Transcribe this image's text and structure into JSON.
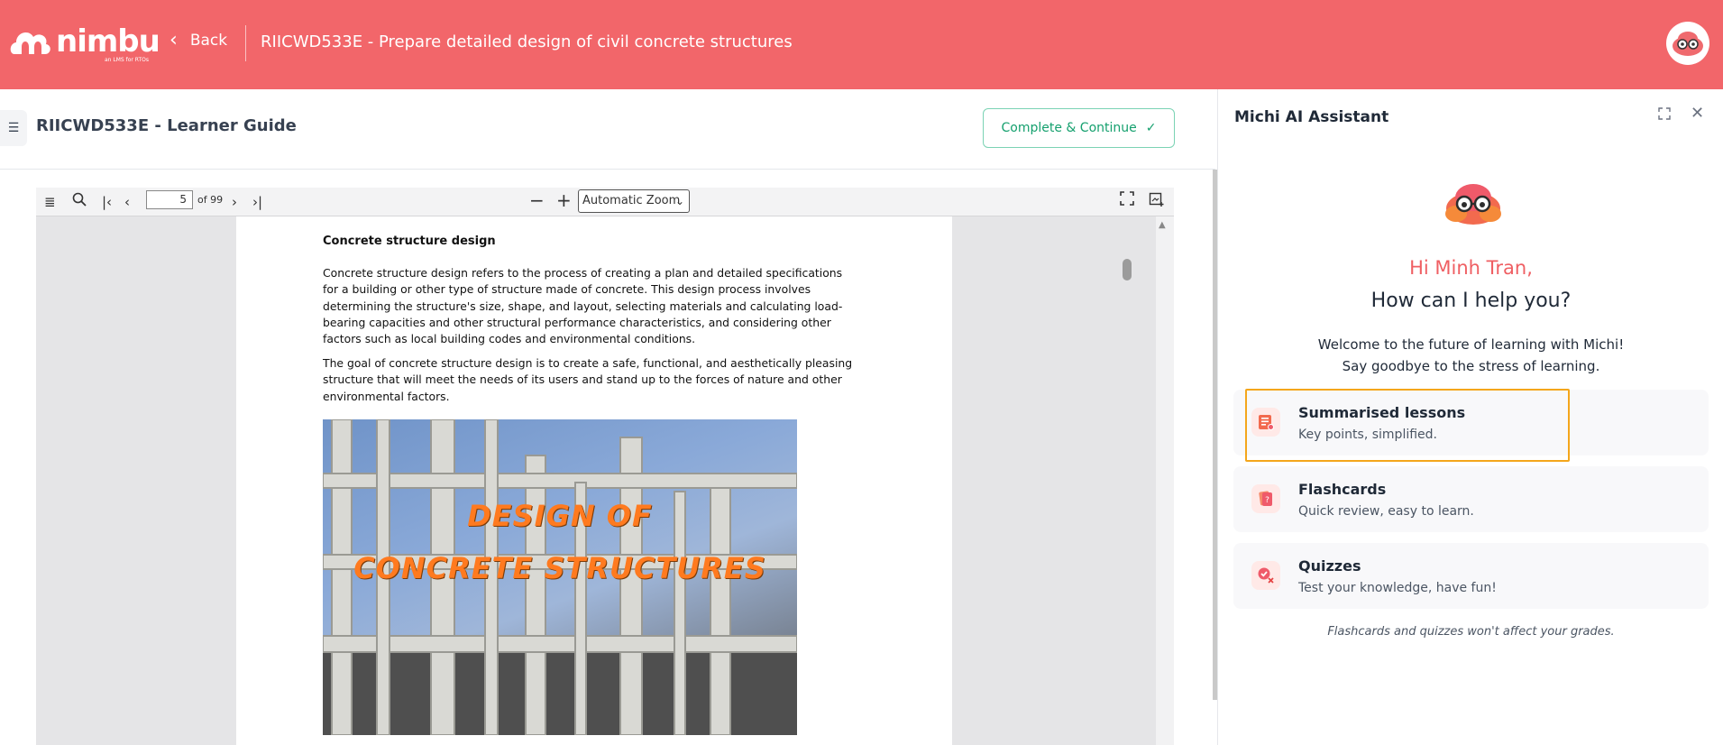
{
  "header": {
    "logo_text": "nimbu",
    "logo_tagline": "an LMS for RTOs",
    "back_label": "Back",
    "course_title": "RIICWD533E - Prepare detailed design of civil concrete structures"
  },
  "content": {
    "guide_title": "RIICWD533E - Learner Guide",
    "complete_button": "Complete & Continue",
    "complete_check": "✓"
  },
  "pdf_viewer": {
    "current_page": "5",
    "page_of": "of 99",
    "zoom": "Automatic Zoom",
    "page": {
      "heading": "Concrete structure design",
      "paragraph1": "Concrete structure design refers to the process of creating a plan and detailed specifications for a building or other type of structure made of concrete. This design process involves determining the structure's size, shape, and layout, selecting materials and calculating load-bearing capacities and other structural performance characteristics, and considering other factors such as local building codes and environmental conditions.",
      "paragraph2": "The goal of concrete structure design is to create a safe, functional, and aesthetically pleasing structure that will meet the needs of its users and stand up to the forces of nature and other environmental factors.",
      "image_text_line1": "DESIGN OF",
      "image_text_line2": "CONCRETE STRUCTURES"
    }
  },
  "assistant": {
    "title": "Michi AI Assistant",
    "greeting_name": "Hi Minh Tran,",
    "greeting_question": "How can I help you?",
    "welcome_line1": "Welcome to the future of learning with Michi!",
    "welcome_line2": "Say goodbye to the stress of learning.",
    "options": [
      {
        "title": "Summarised lessons",
        "subtitle": "Key points, simplified.",
        "icon": "summary-icon"
      },
      {
        "title": "Flashcards",
        "subtitle": "Quick review, easy to learn.",
        "icon": "flashcard-icon"
      },
      {
        "title": "Quizzes",
        "subtitle": "Test your knowledge, have fun!",
        "icon": "quiz-icon"
      }
    ],
    "note": "Flashcards and quizzes won't affect your grades."
  },
  "colors": {
    "brand": "#f2666a",
    "accent_green": "#15a06e",
    "highlight": "#f4a61b"
  }
}
